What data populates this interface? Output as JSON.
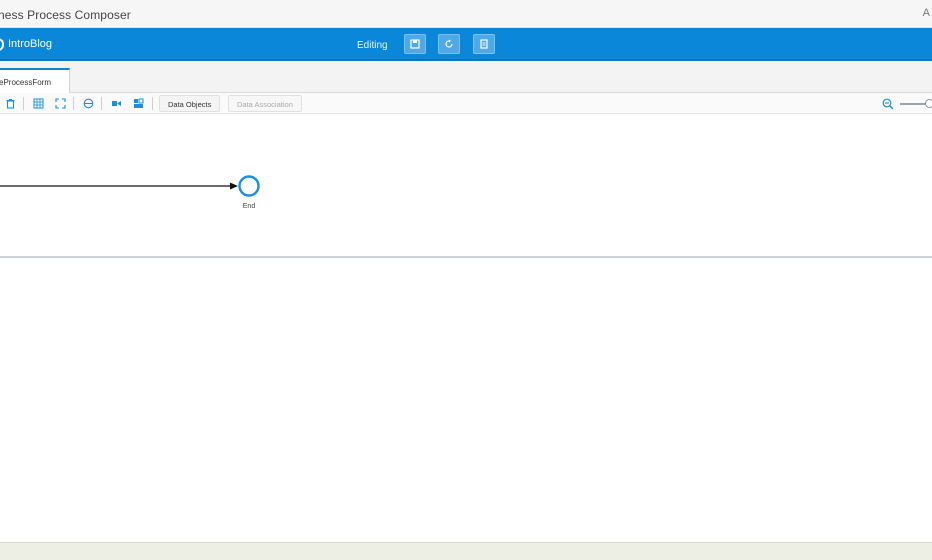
{
  "window": {
    "title": "ness Process Composer",
    "corner_glyph": "A"
  },
  "header": {
    "brand": "IntroBlog",
    "status": "Editing",
    "buttons": [
      {
        "icon": "save-icon"
      },
      {
        "icon": "refresh-icon"
      },
      {
        "icon": "document-icon"
      }
    ]
  },
  "tabs": [
    {
      "label": "eProcessForm",
      "active": true
    }
  ],
  "toolbar": {
    "icons": [
      "trash-icon",
      "grid-icon",
      "fit-icon",
      "print-icon",
      "view-icon",
      "layout-icon"
    ],
    "data_objects_label": "Data Objects",
    "data_association_label": "Data Association"
  },
  "diagram": {
    "end_event_label": "End",
    "accent": "#1a8fe0"
  },
  "colors": {
    "appbar": "#0a87d8",
    "status_bar": "#eeefe4"
  }
}
